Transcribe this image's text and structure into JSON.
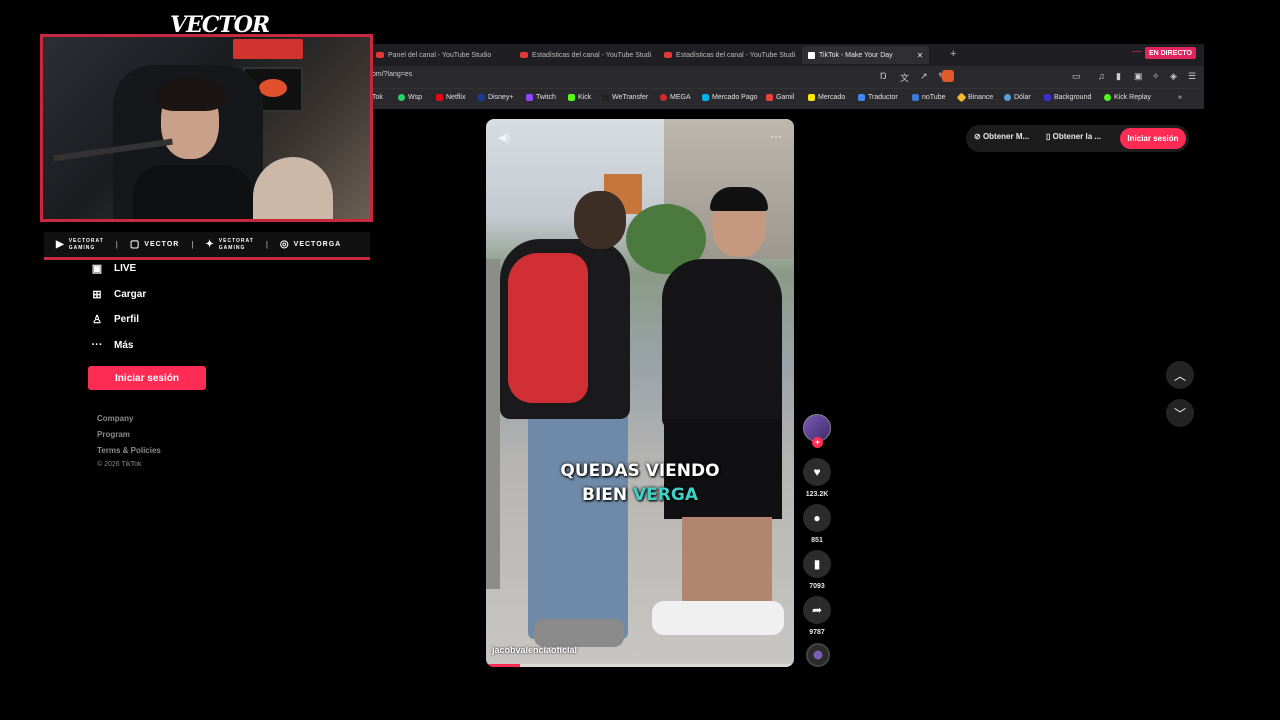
{
  "streamer": {
    "logo": "VECTOR",
    "socials": [
      {
        "icon": "youtube-icon",
        "line1": "VECTORAT",
        "line2": "GAMING"
      },
      {
        "icon": "twitch-icon",
        "label": "VECTOR"
      },
      {
        "icon": "twitter-icon",
        "line1": "VECTORAT",
        "line2": "GAMING"
      },
      {
        "icon": "instagram-icon",
        "label": "VECTORGA"
      }
    ]
  },
  "browser": {
    "tabs": [
      {
        "label": "Panel del canal - YouTube Studio",
        "icon": "youtube-icon"
      },
      {
        "label": "Estadísticas del canal - YouTube Studi",
        "icon": "youtube-icon"
      },
      {
        "label": "Estadísticas del canal - YouTube Studi",
        "icon": "youtube-icon"
      },
      {
        "label": "TikTok - Make Your Day",
        "icon": "tiktok-icon",
        "active": true
      }
    ],
    "live_badge": "EN DIRECTO",
    "url": "om/?lang=es",
    "bookmarks": [
      "Tok",
      "Wsp",
      "Netflix",
      "Disney+",
      "Twitch",
      "Kick",
      "WeTransfer",
      "MEGA",
      "Mercado Pago",
      "Gamil",
      "Mercado",
      "Traductor",
      "noTube",
      "Binance",
      "Dólar",
      "Background",
      "Kick Replay"
    ],
    "colors": {
      "accent": "#fe2c55",
      "frame": "#c8283e"
    }
  },
  "sidebar": {
    "items": [
      {
        "label": "LIVE",
        "icon": "live-tv-icon"
      },
      {
        "label": "Cargar",
        "icon": "upload-icon"
      },
      {
        "label": "Perfil",
        "icon": "profile-icon"
      },
      {
        "label": "Más",
        "icon": "more-dots-icon"
      }
    ],
    "login_button": "Iniciar sesión",
    "footer_links": [
      "Company",
      "Program",
      "Terms & Policies"
    ],
    "copyright": "© 2026 TikTok"
  },
  "video": {
    "caption_line1": "QUEDAS VIENDO",
    "caption_line2_a": "BIEN ",
    "caption_line2_b": "VERGA",
    "author": "jacobvalenciaoficial",
    "progress": 0.11
  },
  "actions": {
    "likes": "123.2K",
    "comments": "851",
    "saves": "7093",
    "shares": "9787"
  },
  "header": {
    "get_app_1": "Obtener M...",
    "get_app_2": "Obtener la ...",
    "login": "Iniciar sesión"
  }
}
